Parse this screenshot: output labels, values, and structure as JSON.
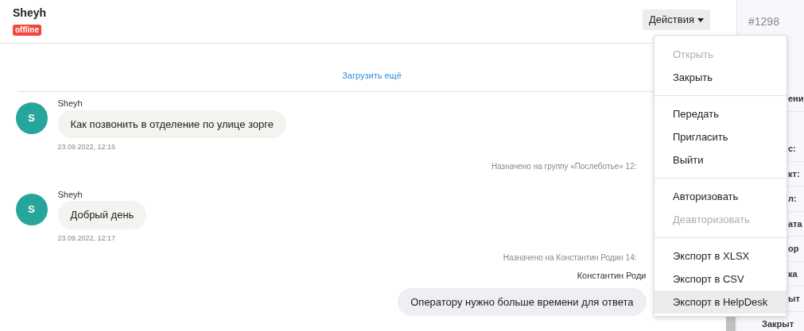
{
  "header": {
    "name": "Sheyh",
    "status": "offline",
    "actions_button": "Действия"
  },
  "load_more": "Загрузить ещё",
  "messages": [
    {
      "kind": "client",
      "author": "Sheyh",
      "avatar": "S",
      "text": "Как позвонить в отделение по улице зорге",
      "time": "23.09.2022, 12:16"
    },
    {
      "kind": "system",
      "text": "Назначено на группу «Послеботье» 12:"
    },
    {
      "kind": "client",
      "author": "Sheyh",
      "avatar": "S",
      "text": "Добрый день",
      "time": "23.09.2022, 12:17"
    },
    {
      "kind": "system",
      "text": "Назначено на Константин Родин 14:"
    },
    {
      "kind": "operator",
      "author": "Константин Роди",
      "text": "Оператору нужно больше времени для ответа"
    }
  ],
  "sidebar": {
    "ticket": "#1298",
    "rows": [
      {
        "text": "ени",
        "covered": true
      },
      {
        "text": "с:",
        "covered": true
      },
      {
        "text": "кт:",
        "covered": true
      },
      {
        "text": "л:",
        "covered": true
      },
      {
        "text": "ата",
        "covered": true
      },
      {
        "text": "ор",
        "covered": true
      },
      {
        "text": "ка",
        "covered": true
      },
      {
        "text": "ыт",
        "covered": true
      },
      {
        "text": "Закрыт",
        "covered": false
      }
    ]
  },
  "menu": [
    [
      {
        "label": "Открыть",
        "disabled": true,
        "highlighted": false
      },
      {
        "label": "Закрыть",
        "disabled": false,
        "highlighted": false
      }
    ],
    [
      {
        "label": "Передать",
        "disabled": false,
        "highlighted": false
      },
      {
        "label": "Пригласить",
        "disabled": false,
        "highlighted": false
      },
      {
        "label": "Выйти",
        "disabled": false,
        "highlighted": false
      }
    ],
    [
      {
        "label": "Авторизовать",
        "disabled": false,
        "highlighted": false
      },
      {
        "label": "Деавторизовать",
        "disabled": true,
        "highlighted": false
      }
    ],
    [
      {
        "label": "Экспорт в XLSX",
        "disabled": false,
        "highlighted": false
      },
      {
        "label": "Экспорт в CSV",
        "disabled": false,
        "highlighted": false
      },
      {
        "label": "Экспорт в HelpDesk",
        "disabled": false,
        "highlighted": true
      }
    ]
  ]
}
